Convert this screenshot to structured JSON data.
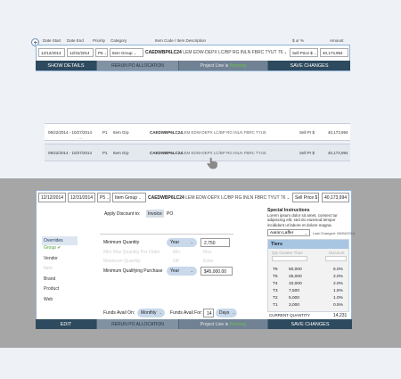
{
  "top": {
    "headers": {
      "date_start": "Date Start",
      "date_end": "Date End",
      "priority": "Priority",
      "category": "Category",
      "item_code_desc": "Item Code / Item Description",
      "dollar_pct": "$ or %",
      "amount": "Amount"
    },
    "edit_row": {
      "date_start": "12/12/2014",
      "date_end": "12/31/2014",
      "priority": "P5",
      "category": "Item Group",
      "item_code": "CAEDWBP6LC24",
      "item_desc": "LEM EDW-DEPX LC/BP RG INLN FBRC TYUT 76",
      "price_type": "Sell Price $",
      "amount": "40,173,994"
    },
    "actionbar": {
      "show_details": "SHOW DETAILS",
      "rerun": "RERUN PO ALLOCATION",
      "project_line": "Project Line is",
      "project_status": "Running",
      "save": "SAVE CHANGES"
    },
    "rows": [
      {
        "dates": "09/22/2014 - 10/27/2014",
        "priority": "P1",
        "category": "Item Grp",
        "item_code": "CAEDWBP6LC24",
        "item_desc": "LEM EDW-DEPX LC/BP RG INLN FBRC TYU5",
        "price_type": "Sell Pr $",
        "amount": "40,173,994"
      },
      {
        "dates": "09/22/2014 - 10/27/2014",
        "priority": "P1",
        "category": "Item Grp",
        "item_code": "CAEDWBP6LC24",
        "item_desc": "LEM EDW-DEPX LC/BP RG INLN FBRC TYU5",
        "price_type": "Sell Pr $",
        "amount": "40,173,994"
      }
    ]
  },
  "panel": {
    "edit_row": {
      "date_start": "12/12/2014",
      "date_end": "12/31/2014",
      "priority": "P5",
      "category": "Item Group",
      "item_code": "CAEDWBP6LC24",
      "item_desc": "LEM EDW-DEPX LC/BP RG INLN FBRC TYUT 76",
      "price_type": "Sell Price $",
      "amount": "40,173,994"
    },
    "apply_discount": {
      "label": "Apply Discount to:",
      "option_invoice": "Invoice",
      "option_po": "PO"
    },
    "sidebar": {
      "title": "Overrides",
      "items": [
        "Group",
        "Vendor",
        "Item",
        "Brand",
        "Product",
        "Web"
      ]
    },
    "form": {
      "min_qty_label": "Minimum Quantity",
      "min_qty_unit": "Year",
      "min_qty_value": "2,750",
      "min_max_qty_label": "Min/ Max Quantity Per Order",
      "min_max_qty_unit": "Min",
      "min_max_qty_value": "Max",
      "max_qty_label": "Maximum Quantity",
      "max_qty_unit": "Off",
      "max_qty_value": "Enter",
      "min_purchase_label": "Minimum Qualifying Purchase",
      "min_purchase_unit": "Year",
      "min_purchase_value": "$45,000.00",
      "funds_avail_on_label": "Funds Avail On:",
      "funds_avail_on_value": "Monthly",
      "funds_avail_for_label": "Funds Avail For:",
      "funds_avail_for_num": "14",
      "funds_avail_for_unit": "Days"
    },
    "special": {
      "title": "Special Instructions",
      "body_lines": [
        "Lorem ipsum dolor sit amet, consect tur",
        "adipiscing elit, sed do eiusmod tempor",
        "incididunt ut labore et dolore magna."
      ],
      "user": "Aaron Laffer",
      "last_changed": "Last Changed: 08/04/2014"
    },
    "tiers": {
      "title": "Tiers",
      "col_qty": "Qty Greater Than",
      "col_discount": "Discount",
      "rows": [
        {
          "tier": "T6",
          "qty": "50,000",
          "pct": "5.0%"
        },
        {
          "tier": "T5",
          "qty": "25,000",
          "pct": "2.0%"
        },
        {
          "tier": "T4",
          "qty": "10,000",
          "pct": "2.0%"
        },
        {
          "tier": "T3",
          "qty": "7,500",
          "pct": "1.5%"
        },
        {
          "tier": "T2",
          "qty": "5,000",
          "pct": "1.0%"
        },
        {
          "tier": "T1",
          "qty": "3,000",
          "pct": "0.5%"
        }
      ],
      "current_qty_label": "CURRENT QUANTITY",
      "current_qty_value": "14,231"
    },
    "actionbar": {
      "edit": "EDIT",
      "rerun": "RERUN PO ALLOCATION",
      "project_line": "Project Line is",
      "project_status": "Running",
      "save": "SAVE CHANGES"
    }
  },
  "colors": {
    "accent_navy": "#2e4a5e",
    "status_green": "#6bbf4e",
    "highlight_blue": "#8fb2d6"
  }
}
